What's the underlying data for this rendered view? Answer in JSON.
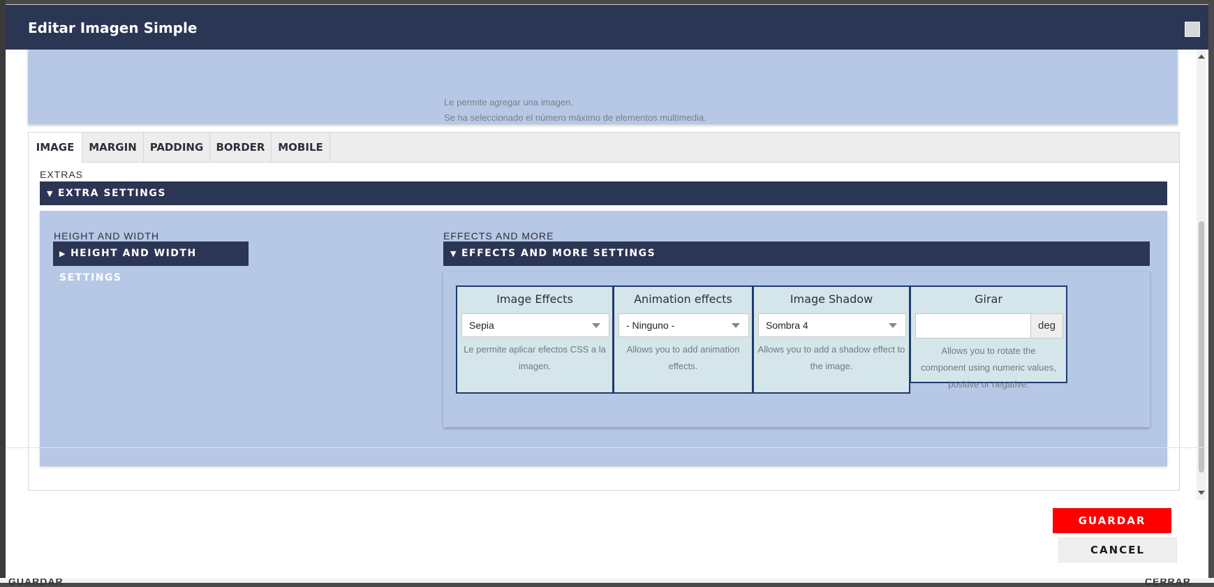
{
  "dialog": {
    "title": "Editar Imagen Simple",
    "close_icon": "close-icon"
  },
  "media": {
    "help_lines": [
      "Le permite agregar una imagen.",
      "Se ha seleccionado el número máximo de elementos multimedia."
    ]
  },
  "tabs": [
    "IMAGE",
    "MARGIN",
    "PADDING",
    "BORDER",
    "MOBILE"
  ],
  "active_tab": "IMAGE",
  "extras": {
    "label": "EXTRAS",
    "bar_label": "EXTRA SETTINGS",
    "height_width": {
      "label": "HEIGHT AND WIDTH",
      "bar_label": "HEIGHT AND WIDTH SETTINGS"
    },
    "effects": {
      "label": "EFFECTS AND MORE",
      "bar_label": "EFFECTS AND MORE SETTINGS",
      "cards": [
        {
          "title": "Image Effects",
          "value": "Sepia",
          "help": "Le permite aplicar efectos CSS a la imagen."
        },
        {
          "title": "Animation effects",
          "value": "- Ninguno -",
          "help": "Allows you to add animation effects."
        },
        {
          "title": "Image Shadow",
          "value": "Sombra 4",
          "help": "Allows you to add a shadow effect to the image."
        },
        {
          "title": "Girar",
          "value": "",
          "unit": "deg",
          "help": "Allows you to rotate the component using numeric values, positive or negative."
        }
      ]
    }
  },
  "footer": {
    "save_label": "GUARDAR",
    "cancel_label": "CANCEL"
  },
  "underlying": {
    "left_text": "GUARDAR",
    "right_text": "CERRAR"
  },
  "colors": {
    "header": "#2b3554",
    "panel": "#b6c8e6",
    "card": "#d4e6ea",
    "save": "#ff0000"
  }
}
